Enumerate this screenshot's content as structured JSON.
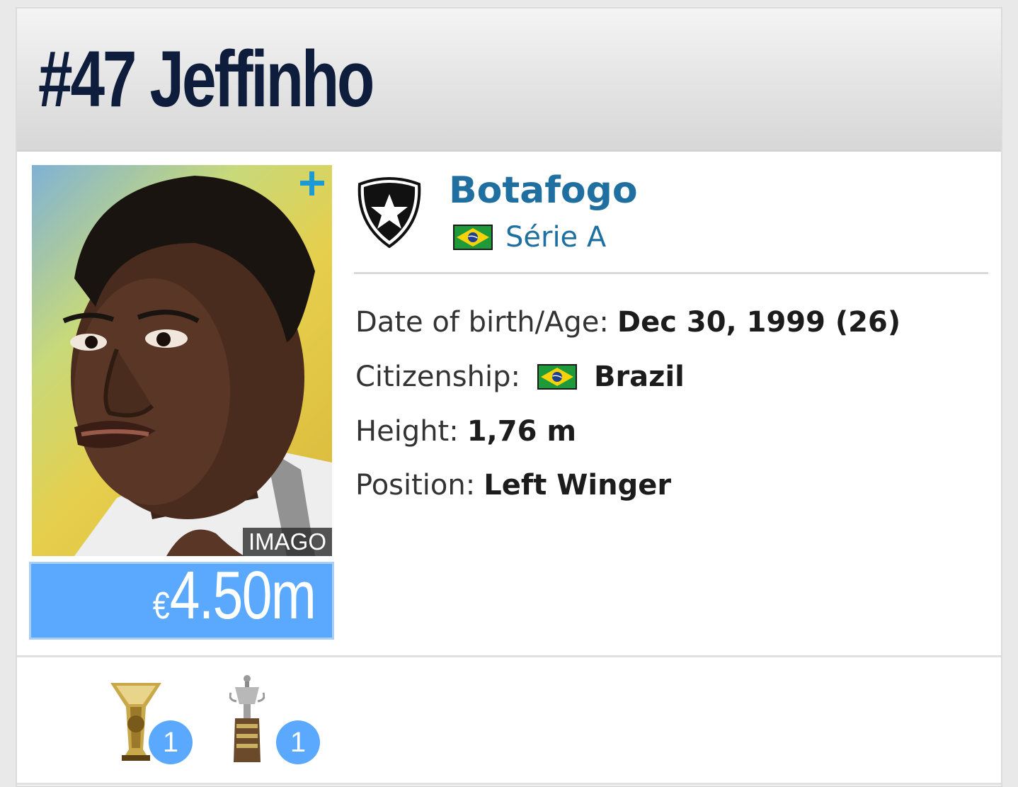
{
  "header": {
    "title": "#47 Jeffinho"
  },
  "photo": {
    "credit": "IMAGO",
    "plus_icon": "plus-icon"
  },
  "market_value": {
    "currency": "€",
    "amount": "4.50",
    "unit": "m"
  },
  "club": {
    "name": "Botafogo",
    "crest_icon": "botafogo-crest-icon",
    "league": "Série A",
    "league_flag": "brazil-flag-icon"
  },
  "info": {
    "dob_label": "Date of birth/Age:",
    "dob_value": "Dec 30, 1999 (26)",
    "citizenship_label": "Citizenship:",
    "citizenship_value": "Brazil",
    "height_label": "Height:",
    "height_value": "1,76 m",
    "position_label": "Position:",
    "position_value": "Left Winger"
  },
  "trophies": [
    {
      "icon": "league-trophy-icon",
      "count": "1"
    },
    {
      "icon": "libertadores-trophy-icon",
      "count": "1"
    }
  ],
  "colors": {
    "title": "#0f1d3c",
    "club_link": "#1f6fa0",
    "market_value_bg": "#5ba9ff",
    "badge": "#5ba9ff"
  }
}
